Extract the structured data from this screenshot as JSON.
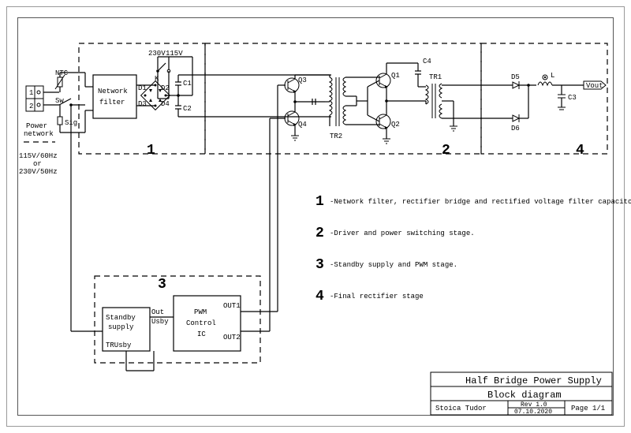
{
  "input": {
    "label": "Power\nnetwork",
    "spec": "115V/60Hz\nor\n230V/50Hz",
    "ntc": "NTC",
    "sw": "Sw",
    "sig": "Sig",
    "pins": [
      "1",
      "2"
    ]
  },
  "stage1": {
    "num": "1",
    "filter_block": "Network\nfilter",
    "sel": {
      "v230": "230V",
      "v115": "115V",
      "k": "K"
    },
    "bridge": [
      "D1",
      "D2",
      "D3",
      "D4"
    ],
    "caps": [
      "C1",
      "C2"
    ],
    "legend": "-Network filter, rectifier bridge and rectified voltage filter capacitors."
  },
  "stage2": {
    "num": "2",
    "q": [
      "Q1",
      "Q2",
      "Q3",
      "Q4"
    ],
    "tr": [
      "TR1",
      "TR2"
    ],
    "cap": "C4",
    "legend": "-Driver and power switching stage."
  },
  "stage3": {
    "num": "3",
    "standby": {
      "block": "Standby\nsupply",
      "out": "Out",
      "usby": "Usby",
      "trusby": "TRUsby"
    },
    "pwm": {
      "block": "PWM\nControl\nIC",
      "out1": "OUT1",
      "out2": "OUT2"
    },
    "legend": "-Standby supply and PWM stage."
  },
  "stage4": {
    "num": "4",
    "d": [
      "D5",
      "D6"
    ],
    "l": "L",
    "c": "C3",
    "vout": "Vout",
    "legend": "-Final  rectifier stage"
  },
  "titleblock": {
    "title": "Half Bridge Power Supply",
    "subtitle": "Block diagram",
    "author": "Stoica Tudor",
    "rev": "Rev 1.0",
    "date": "07.10.2020",
    "page": "Page 1/1"
  }
}
